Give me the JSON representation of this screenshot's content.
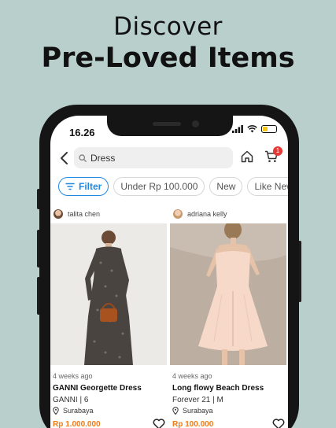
{
  "promo": {
    "line1": "Discover",
    "line2": "Pre-Loved Items"
  },
  "status_bar": {
    "time": "16.26"
  },
  "search": {
    "query": "Dress"
  },
  "cart": {
    "badge_count": "1"
  },
  "filters": {
    "filter_label": "Filter",
    "chips": [
      "Under Rp 100.000",
      "New",
      "Like New"
    ]
  },
  "products": [
    {
      "seller": "talita chen",
      "posted": "4 weeks ago",
      "name": "GANNI Georgette Dress",
      "brand_size": "GANNI  | 6",
      "location": "Surabaya",
      "price": "Rp 1.000.000"
    },
    {
      "seller": "adriana kelly",
      "posted": "4 weeks ago",
      "name": "Long flowy Beach Dress",
      "brand_size": "Forever 21  | M",
      "location": "Surabaya",
      "price": "Rp 100.000"
    }
  ],
  "colors": {
    "background": "#b9cfcc",
    "accent_blue": "#1e88e5",
    "price_orange": "#f07b16",
    "badge_red": "#e53935"
  }
}
